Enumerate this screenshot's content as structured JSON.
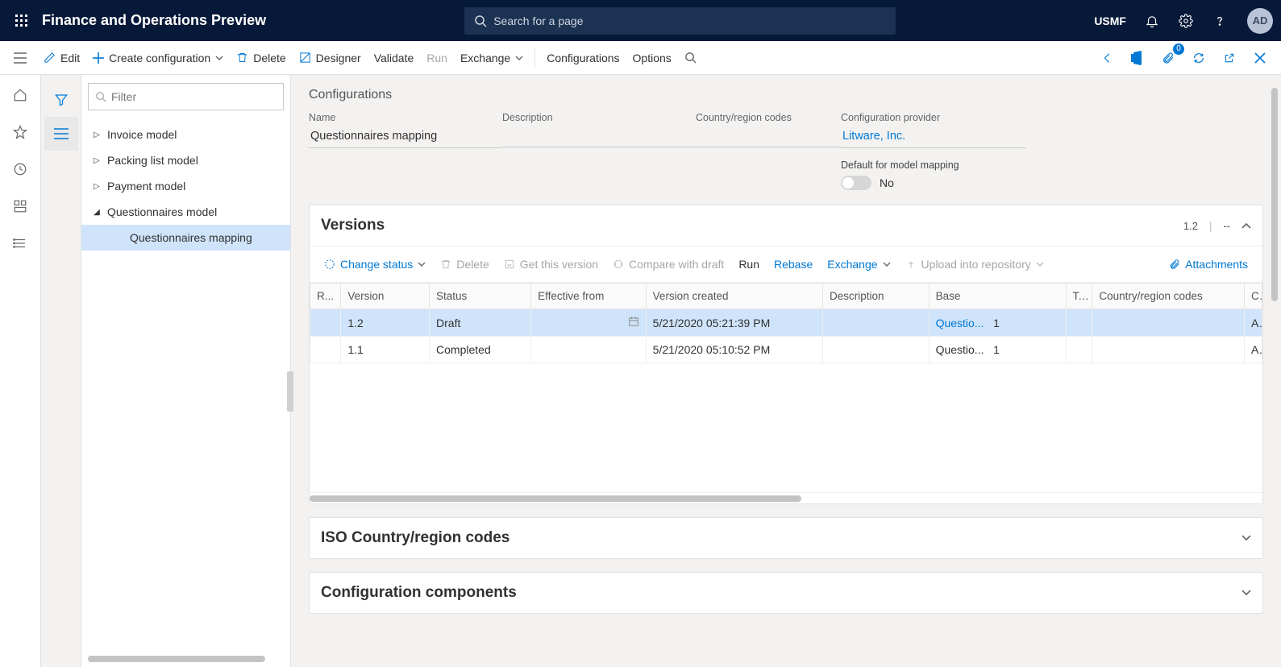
{
  "topbar": {
    "title": "Finance and Operations Preview",
    "search_placeholder": "Search for a page",
    "company": "USMF",
    "avatar_initials": "AD"
  },
  "actionbar": {
    "edit": "Edit",
    "create": "Create configuration",
    "delete": "Delete",
    "designer": "Designer",
    "validate": "Validate",
    "run": "Run",
    "exchange": "Exchange",
    "configurations": "Configurations",
    "options": "Options",
    "attach_badge": "0"
  },
  "tree": {
    "filter_placeholder": "Filter",
    "items": [
      {
        "label": "Invoice model",
        "expandable": true,
        "expanded": false,
        "level": 0
      },
      {
        "label": "Packing list model",
        "expandable": true,
        "expanded": false,
        "level": 0
      },
      {
        "label": "Payment model",
        "expandable": true,
        "expanded": false,
        "level": 0
      },
      {
        "label": "Questionnaires model",
        "expandable": true,
        "expanded": true,
        "level": 0
      },
      {
        "label": "Questionnaires mapping",
        "expandable": false,
        "expanded": false,
        "level": 1,
        "selected": true
      }
    ]
  },
  "header": {
    "section": "Configurations",
    "name_label": "Name",
    "name_value": "Questionnaires mapping",
    "desc_label": "Description",
    "desc_value": "",
    "ccodes_label": "Country/region codes",
    "ccodes_value": "",
    "provider_label": "Configuration provider",
    "provider_value": "Litware, Inc.",
    "default_mm_label": "Default for model mapping",
    "default_mm_value": "No"
  },
  "versions": {
    "title": "Versions",
    "summary": "1.2",
    "summary_extra": "--",
    "toolbar": {
      "change_status": "Change status",
      "delete": "Delete",
      "get_version": "Get this version",
      "compare": "Compare with draft",
      "run": "Run",
      "rebase": "Rebase",
      "exchange": "Exchange",
      "upload": "Upload into repository",
      "attachments": "Attachments"
    },
    "columns": [
      "R...",
      "Version",
      "Status",
      "Effective from",
      "Version created",
      "Description",
      "Base",
      "T...",
      "Country/region codes",
      "C"
    ],
    "rows": [
      {
        "r": "",
        "version": "1.2",
        "status": "Draft",
        "effective": "",
        "created": "5/21/2020 05:21:39 PM",
        "desc": "",
        "base": "Questio...",
        "base_num": "1",
        "t": "",
        "cc": "",
        "c": "A",
        "selected": true
      },
      {
        "r": "",
        "version": "1.1",
        "status": "Completed",
        "effective": "",
        "created": "5/21/2020 05:10:52 PM",
        "desc": "",
        "base": "Questio...",
        "base_num": "1",
        "t": "",
        "cc": "",
        "c": "A",
        "selected": false
      }
    ]
  },
  "iso_section": {
    "title": "ISO Country/region codes"
  },
  "components_section": {
    "title": "Configuration components"
  }
}
